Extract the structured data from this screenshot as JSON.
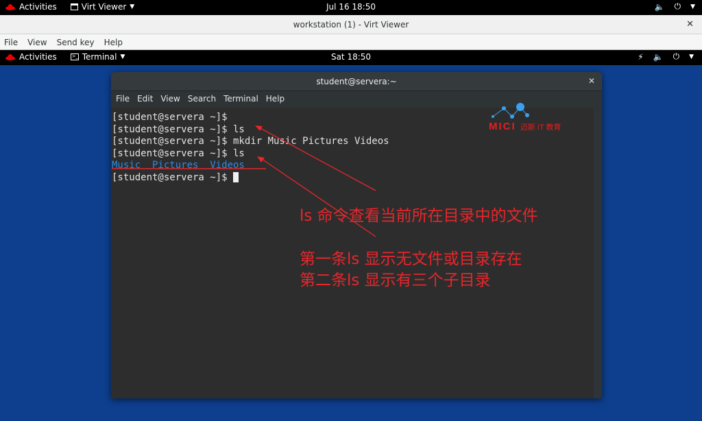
{
  "host_bar": {
    "activities": "Activities",
    "app_name": "Virt Viewer",
    "clock": "Jul 16  18:50"
  },
  "viewer": {
    "title": "workstation (1) - Virt Viewer",
    "menu": [
      "File",
      "View",
      "Send key",
      "Help"
    ]
  },
  "guest_bar": {
    "activities": "Activities",
    "app_name": "Terminal",
    "clock": "Sat 18:50"
  },
  "terminal": {
    "title": "student@servera:~",
    "menu": [
      "File",
      "Edit",
      "View",
      "Search",
      "Terminal",
      "Help"
    ],
    "lines": [
      "[student@servera ~]$",
      "[student@servera ~]$ ls",
      "[student@servera ~]$ mkdir Music Pictures Videos",
      "[student@servera ~]$ ls"
    ],
    "ls_output": "Music  Pictures  Videos",
    "prompt": "[student@servera ~]$ "
  },
  "watermark": {
    "brand": "MICI",
    "sub": "迈斯 IT 教育"
  },
  "annotations": {
    "line1": "ls 命令查看当前所在目录中的文件",
    "line2": "第一条ls 显示无文件或目录存在",
    "line3": "第二条ls 显示有三个子目录"
  },
  "colors": {
    "annotation": "#e8262b",
    "ls_dir": "#2a8ce6",
    "desktop": "#0d3f8e"
  }
}
